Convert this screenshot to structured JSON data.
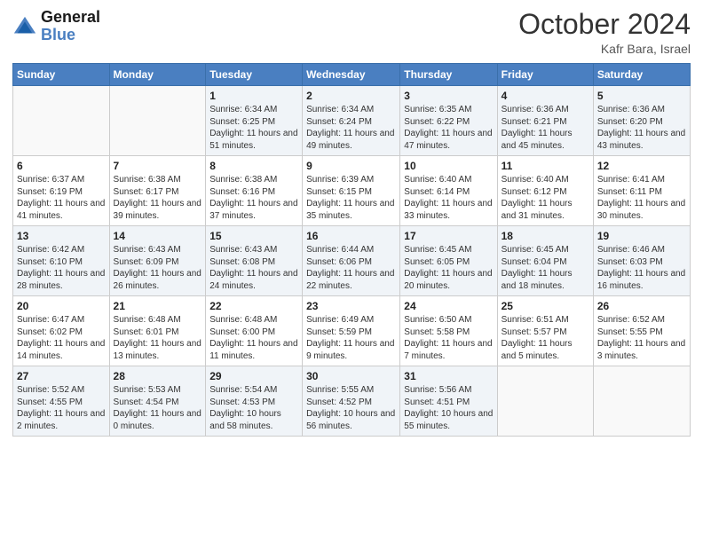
{
  "header": {
    "logo_general": "General",
    "logo_blue": "Blue",
    "month_year": "October 2024",
    "location": "Kafr Bara, Israel"
  },
  "weekdays": [
    "Sunday",
    "Monday",
    "Tuesday",
    "Wednesday",
    "Thursday",
    "Friday",
    "Saturday"
  ],
  "weeks": [
    [
      {
        "day": "",
        "sunrise": "",
        "sunset": "",
        "daylight": ""
      },
      {
        "day": "",
        "sunrise": "",
        "sunset": "",
        "daylight": ""
      },
      {
        "day": "1",
        "sunrise": "Sunrise: 6:34 AM",
        "sunset": "Sunset: 6:25 PM",
        "daylight": "Daylight: 11 hours and 51 minutes."
      },
      {
        "day": "2",
        "sunrise": "Sunrise: 6:34 AM",
        "sunset": "Sunset: 6:24 PM",
        "daylight": "Daylight: 11 hours and 49 minutes."
      },
      {
        "day": "3",
        "sunrise": "Sunrise: 6:35 AM",
        "sunset": "Sunset: 6:22 PM",
        "daylight": "Daylight: 11 hours and 47 minutes."
      },
      {
        "day": "4",
        "sunrise": "Sunrise: 6:36 AM",
        "sunset": "Sunset: 6:21 PM",
        "daylight": "Daylight: 11 hours and 45 minutes."
      },
      {
        "day": "5",
        "sunrise": "Sunrise: 6:36 AM",
        "sunset": "Sunset: 6:20 PM",
        "daylight": "Daylight: 11 hours and 43 minutes."
      }
    ],
    [
      {
        "day": "6",
        "sunrise": "Sunrise: 6:37 AM",
        "sunset": "Sunset: 6:19 PM",
        "daylight": "Daylight: 11 hours and 41 minutes."
      },
      {
        "day": "7",
        "sunrise": "Sunrise: 6:38 AM",
        "sunset": "Sunset: 6:17 PM",
        "daylight": "Daylight: 11 hours and 39 minutes."
      },
      {
        "day": "8",
        "sunrise": "Sunrise: 6:38 AM",
        "sunset": "Sunset: 6:16 PM",
        "daylight": "Daylight: 11 hours and 37 minutes."
      },
      {
        "day": "9",
        "sunrise": "Sunrise: 6:39 AM",
        "sunset": "Sunset: 6:15 PM",
        "daylight": "Daylight: 11 hours and 35 minutes."
      },
      {
        "day": "10",
        "sunrise": "Sunrise: 6:40 AM",
        "sunset": "Sunset: 6:14 PM",
        "daylight": "Daylight: 11 hours and 33 minutes."
      },
      {
        "day": "11",
        "sunrise": "Sunrise: 6:40 AM",
        "sunset": "Sunset: 6:12 PM",
        "daylight": "Daylight: 11 hours and 31 minutes."
      },
      {
        "day": "12",
        "sunrise": "Sunrise: 6:41 AM",
        "sunset": "Sunset: 6:11 PM",
        "daylight": "Daylight: 11 hours and 30 minutes."
      }
    ],
    [
      {
        "day": "13",
        "sunrise": "Sunrise: 6:42 AM",
        "sunset": "Sunset: 6:10 PM",
        "daylight": "Daylight: 11 hours and 28 minutes."
      },
      {
        "day": "14",
        "sunrise": "Sunrise: 6:43 AM",
        "sunset": "Sunset: 6:09 PM",
        "daylight": "Daylight: 11 hours and 26 minutes."
      },
      {
        "day": "15",
        "sunrise": "Sunrise: 6:43 AM",
        "sunset": "Sunset: 6:08 PM",
        "daylight": "Daylight: 11 hours and 24 minutes."
      },
      {
        "day": "16",
        "sunrise": "Sunrise: 6:44 AM",
        "sunset": "Sunset: 6:06 PM",
        "daylight": "Daylight: 11 hours and 22 minutes."
      },
      {
        "day": "17",
        "sunrise": "Sunrise: 6:45 AM",
        "sunset": "Sunset: 6:05 PM",
        "daylight": "Daylight: 11 hours and 20 minutes."
      },
      {
        "day": "18",
        "sunrise": "Sunrise: 6:45 AM",
        "sunset": "Sunset: 6:04 PM",
        "daylight": "Daylight: 11 hours and 18 minutes."
      },
      {
        "day": "19",
        "sunrise": "Sunrise: 6:46 AM",
        "sunset": "Sunset: 6:03 PM",
        "daylight": "Daylight: 11 hours and 16 minutes."
      }
    ],
    [
      {
        "day": "20",
        "sunrise": "Sunrise: 6:47 AM",
        "sunset": "Sunset: 6:02 PM",
        "daylight": "Daylight: 11 hours and 14 minutes."
      },
      {
        "day": "21",
        "sunrise": "Sunrise: 6:48 AM",
        "sunset": "Sunset: 6:01 PM",
        "daylight": "Daylight: 11 hours and 13 minutes."
      },
      {
        "day": "22",
        "sunrise": "Sunrise: 6:48 AM",
        "sunset": "Sunset: 6:00 PM",
        "daylight": "Daylight: 11 hours and 11 minutes."
      },
      {
        "day": "23",
        "sunrise": "Sunrise: 6:49 AM",
        "sunset": "Sunset: 5:59 PM",
        "daylight": "Daylight: 11 hours and 9 minutes."
      },
      {
        "day": "24",
        "sunrise": "Sunrise: 6:50 AM",
        "sunset": "Sunset: 5:58 PM",
        "daylight": "Daylight: 11 hours and 7 minutes."
      },
      {
        "day": "25",
        "sunrise": "Sunrise: 6:51 AM",
        "sunset": "Sunset: 5:57 PM",
        "daylight": "Daylight: 11 hours and 5 minutes."
      },
      {
        "day": "26",
        "sunrise": "Sunrise: 6:52 AM",
        "sunset": "Sunset: 5:55 PM",
        "daylight": "Daylight: 11 hours and 3 minutes."
      }
    ],
    [
      {
        "day": "27",
        "sunrise": "Sunrise: 5:52 AM",
        "sunset": "Sunset: 4:55 PM",
        "daylight": "Daylight: 11 hours and 2 minutes."
      },
      {
        "day": "28",
        "sunrise": "Sunrise: 5:53 AM",
        "sunset": "Sunset: 4:54 PM",
        "daylight": "Daylight: 11 hours and 0 minutes."
      },
      {
        "day": "29",
        "sunrise": "Sunrise: 5:54 AM",
        "sunset": "Sunset: 4:53 PM",
        "daylight": "Daylight: 10 hours and 58 minutes."
      },
      {
        "day": "30",
        "sunrise": "Sunrise: 5:55 AM",
        "sunset": "Sunset: 4:52 PM",
        "daylight": "Daylight: 10 hours and 56 minutes."
      },
      {
        "day": "31",
        "sunrise": "Sunrise: 5:56 AM",
        "sunset": "Sunset: 4:51 PM",
        "daylight": "Daylight: 10 hours and 55 minutes."
      },
      {
        "day": "",
        "sunrise": "",
        "sunset": "",
        "daylight": ""
      },
      {
        "day": "",
        "sunrise": "",
        "sunset": "",
        "daylight": ""
      }
    ]
  ]
}
